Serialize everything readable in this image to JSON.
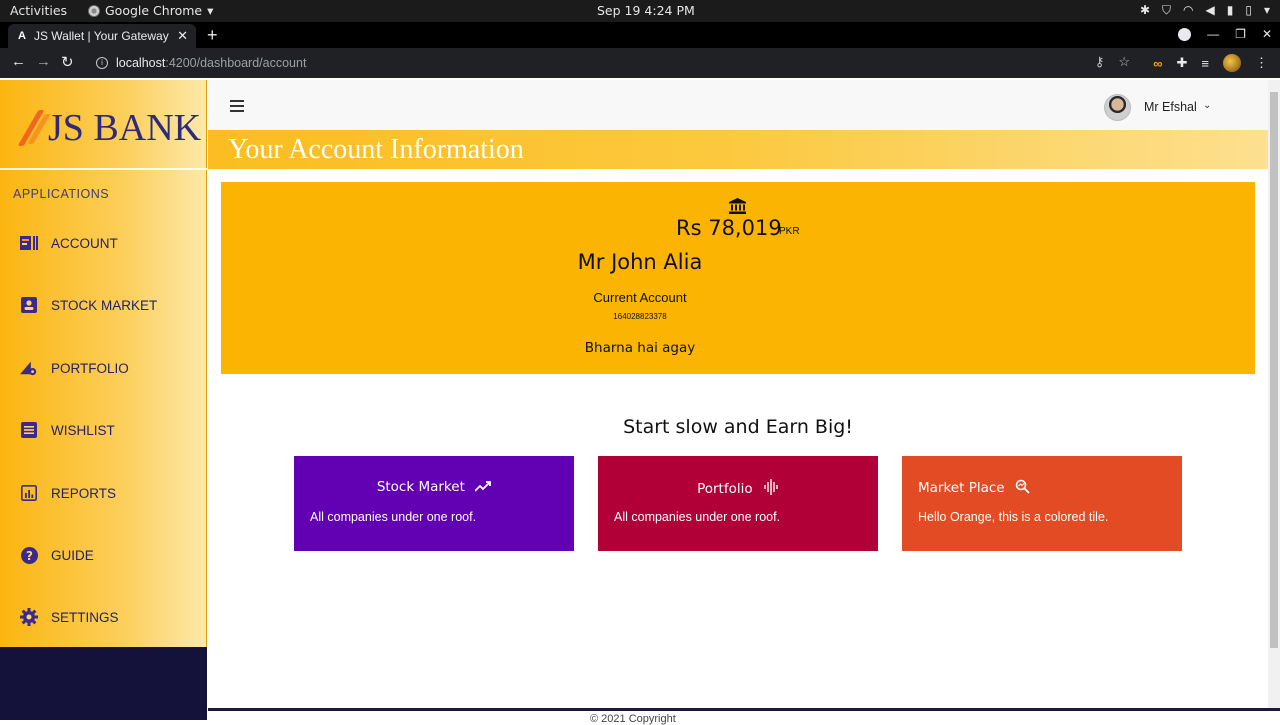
{
  "os_bar": {
    "activities": "Activities",
    "app_name": "Google Chrome",
    "clock": "Sep 19  4:24 PM"
  },
  "browser": {
    "tab_title": "JS Wallet | Your Gateway",
    "tab_favicon": "A",
    "url_host": "localhost",
    "url_path": ":4200/dashboard/account"
  },
  "sidebar": {
    "logo_text": "JS BANK",
    "section_label": "APPLICATIONS",
    "items": [
      {
        "label": "ACCOUNT",
        "icon": "account-icon"
      },
      {
        "label": "STOCK MARKET",
        "icon": "stock-market-icon"
      },
      {
        "label": "PORTFOLIO",
        "icon": "portfolio-icon"
      },
      {
        "label": "WISHLIST",
        "icon": "wishlist-icon"
      },
      {
        "label": "REPORTS",
        "icon": "reports-icon"
      },
      {
        "label": "GUIDE",
        "icon": "help-icon"
      },
      {
        "label": "SETTINGS",
        "icon": "gear-icon"
      }
    ]
  },
  "header": {
    "user_name": "Mr Efshal"
  },
  "page": {
    "title": "Your Account Information",
    "account": {
      "balance": "Rs 78,019",
      "currency": "PKR",
      "holder": "Mr John Alia",
      "type": "Current Account",
      "number": "164028823378",
      "note": "Bharna hai agay"
    },
    "tagline": "Start slow and Earn Big!",
    "tiles": [
      {
        "title": "Stock Market",
        "desc": "All companies under one roof.",
        "color": "#6200b3"
      },
      {
        "title": "Portfolio",
        "desc": "All companies under one roof.",
        "color": "#b10037"
      },
      {
        "title": "Market Place",
        "desc": "Hello Orange, this is a colored tile.",
        "color": "#e34b24"
      }
    ],
    "footer": "© 2021 Copyright"
  },
  "colors": {
    "accent_yellow": "#fcb403",
    "brand_navy": "#2e2a7a",
    "sidebar_bottom": "#14123a"
  }
}
